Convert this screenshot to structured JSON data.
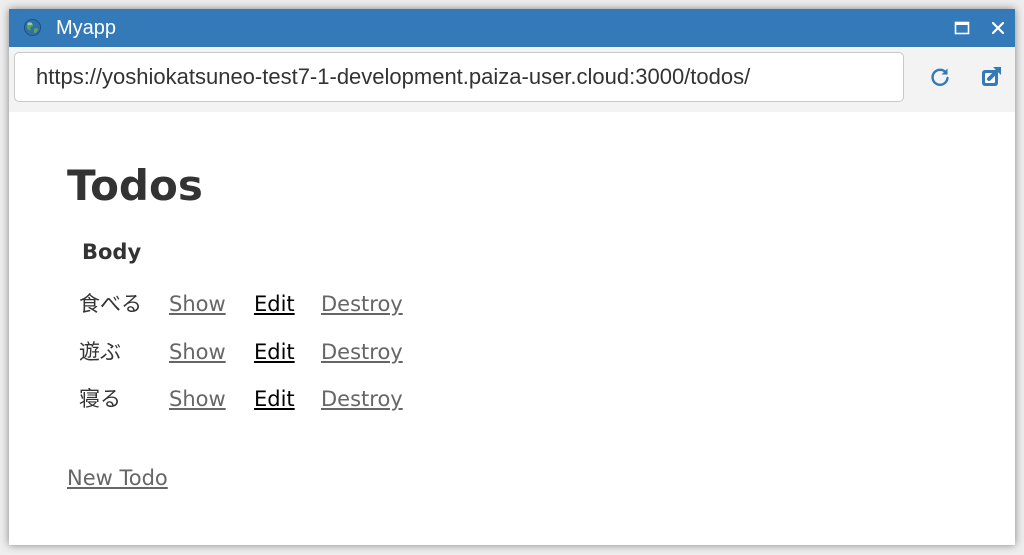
{
  "window": {
    "title": "Myapp",
    "icon": "globe-icon",
    "controls": [
      "maximize-icon",
      "close-icon"
    ],
    "titlebar_color": "#3479b8"
  },
  "addressbar": {
    "url": "https://yoshiokatsuneo-test7-1-development.paiza-user.cloud:3000/todos/",
    "actions": [
      "reload-icon",
      "open-external-icon"
    ],
    "icon_color": "#3479b8"
  },
  "page": {
    "title": "Todos",
    "column_header": "Body",
    "rows": [
      {
        "body": "食べる",
        "show": "Show",
        "edit": "Edit",
        "destroy": "Destroy"
      },
      {
        "body": "遊ぶ",
        "show": "Show",
        "edit": "Edit",
        "destroy": "Destroy"
      },
      {
        "body": "寝る",
        "show": "Show",
        "edit": "Edit",
        "destroy": "Destroy"
      }
    ],
    "new_link": "New Todo",
    "link_color": "#666666"
  }
}
